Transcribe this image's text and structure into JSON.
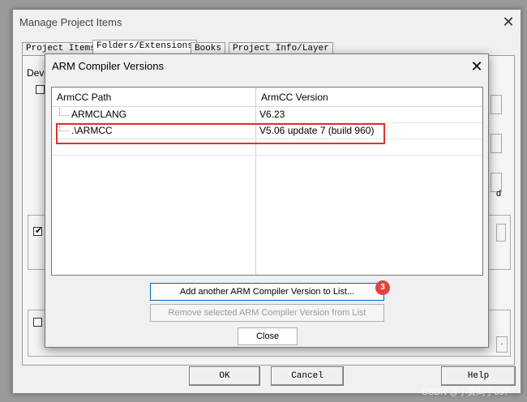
{
  "back_window": {
    "title": "Manage Project Items",
    "close_glyph": "✕",
    "tabs": [
      "Project Items",
      "Folders/Extensions",
      "Books",
      "Project Info/Layer"
    ],
    "active_tab": 1,
    "partial_label": "Devel",
    "partial_right_char": "d",
    "partial_right_char2": ".",
    "buttons": {
      "ok": "OK",
      "cancel": "Cancel",
      "help": "Help"
    }
  },
  "dialog": {
    "title": "ARM Compiler Versions",
    "close_glyph": "✕",
    "columns": [
      "ArmCC Path",
      "ArmCC Version"
    ],
    "rows": [
      {
        "path": "ARMCLANG",
        "version": "V6.23"
      },
      {
        "path": ".\\ARMCC",
        "version": "V5.06 update 7 (build 960)"
      }
    ],
    "highlighted_row": 1,
    "buttons": {
      "add": "Add another ARM Compiler Version to List...",
      "remove": "Remove selected ARM Compiler Version from List",
      "close": "Close"
    },
    "step_badge": "3",
    "highlight_color": "#e03131",
    "badge_color": "#e8413c"
  },
  "watermark": "CSDN @小赛同学807"
}
